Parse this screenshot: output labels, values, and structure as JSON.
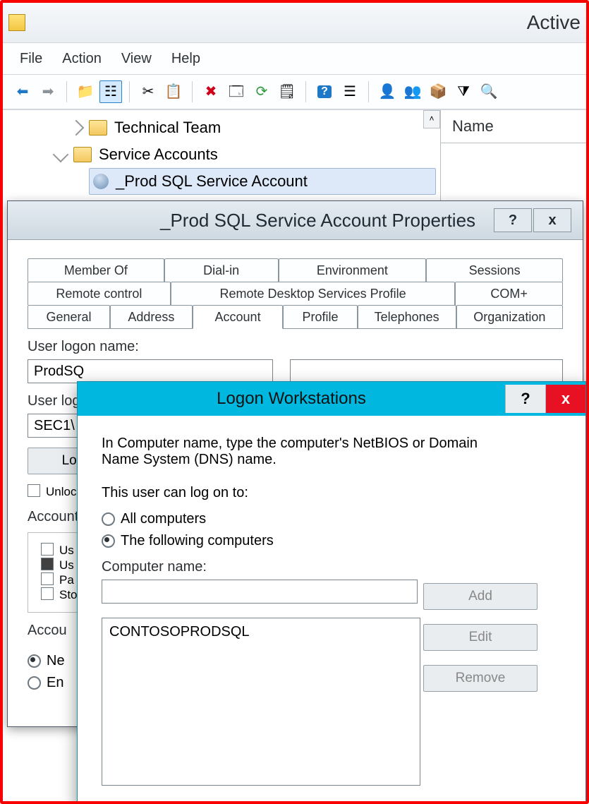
{
  "app": {
    "title": "Active"
  },
  "menubar": {
    "file": "File",
    "action": "Action",
    "view": "View",
    "help": "Help"
  },
  "tree": {
    "tech_team": "Technical Team",
    "service_accounts": "Service Accounts",
    "prod_sql": "_Prod SQL Service Account"
  },
  "right": {
    "name_header": "Name"
  },
  "props": {
    "title": "_Prod SQL Service Account Properties",
    "help": "?",
    "close": "x",
    "tabs_row1": {
      "member_of": "Member Of",
      "dial_in": "Dial-in",
      "environment": "Environment",
      "sessions": "Sessions"
    },
    "tabs_row2": {
      "remote_control": "Remote control",
      "rds_profile": "Remote Desktop Services Profile",
      "com_plus": "COM+"
    },
    "tabs_row3": {
      "general": "General",
      "address": "Address",
      "account": "Account",
      "profile": "Profile",
      "telephones": "Telephones",
      "organization": "Organization"
    },
    "user_logon_name_label": "User logon name:",
    "user_logon_name_value": "ProdSQ",
    "user_logon_label2": "User log",
    "user_logon_value2": "SEC1\\",
    "logon_btn": "Logon",
    "unlock": "Unloc",
    "account_group": "Account",
    "opt1": "Us",
    "opt2": "Us",
    "opt3": "Pa",
    "opt4": "Sto",
    "account_expires": "Accou",
    "never": "Ne",
    "end": "En"
  },
  "logon": {
    "title": "Logon Workstations",
    "help": "?",
    "close": "x",
    "desc": "In Computer name, type the computer's NetBIOS or Domain Name System (DNS) name.",
    "can_log_on": "This user can log on to:",
    "all": "All computers",
    "following": "The following computers",
    "computer_name_label": "Computer name:",
    "computer_name_value": "",
    "list_item_1": "CONTOSOPRODSQL",
    "add": "Add",
    "edit": "Edit",
    "remove": "Remove"
  }
}
